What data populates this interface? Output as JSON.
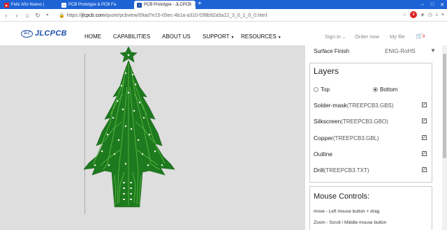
{
  "browser": {
    "tabs": [
      {
        "label": "Feliz Año Nuevo | ",
        "favicon": "youtube-icon",
        "color": "#e02020"
      },
      {
        "label": "PCB Prototype & PCB Fa",
        "favicon": "jlc-icon",
        "color": "#1f4fa8"
      },
      {
        "label": "PCB Prototype - JLCPCB",
        "favicon": "jlc-icon",
        "color": "#1f4fa8",
        "active": true
      }
    ],
    "new_tab": "+",
    "window_controls": [
      "–",
      "□",
      "✕"
    ],
    "address": {
      "prefix": "https://",
      "domain": "jlcpcb.com",
      "path": "/quote/pcbview/09ad7e15-05ec-4b1a-a310-f2f8b92a5a12_3_0_1_0_0.html"
    },
    "abp_count": "2"
  },
  "site": {
    "logo_text": "JLCPCB",
    "logo_badge": "JLC",
    "nav": [
      {
        "label": "HOME",
        "dropdown": false
      },
      {
        "label": "CAPABILITIES",
        "dropdown": false
      },
      {
        "label": "ABOUT US",
        "dropdown": false
      },
      {
        "label": "SUPPORT",
        "dropdown": true
      },
      {
        "label": "RESOURCES",
        "dropdown": true
      }
    ],
    "user_nav": {
      "signin": "Sign in",
      "new_quote": "Order now",
      "my_file": "My file",
      "cart_count": "0"
    }
  },
  "panel": {
    "surface_finish_label": "Surface Finish",
    "surface_finish_value": "ENIG-RoHS",
    "layers_title": "Layers",
    "side_options": [
      {
        "label": "Top",
        "selected": false
      },
      {
        "label": "Bottom",
        "selected": true
      }
    ],
    "layers": [
      {
        "name": "Solder-mask",
        "file": "(TREEPCB3.GBS)",
        "checked": true
      },
      {
        "name": "Silkscreen",
        "file": "(TREEPCB3.GBO)",
        "checked": true
      },
      {
        "name": "Copper",
        "file": "(TREEPCB3.GBL)",
        "checked": true
      },
      {
        "name": "Outline",
        "file": "",
        "checked": true
      },
      {
        "name": "Drill",
        "file": "(TREEPCB3.TXT)",
        "checked": true
      }
    ],
    "mouse_controls_title": "Mouse Controls:",
    "mouse_controls": [
      "move - Left mouse button + drag",
      "Zoom - Scroll / Middle mouse button"
    ]
  },
  "colors": {
    "browser_blue": "#1e63d6",
    "brand_blue": "#1f4fa8",
    "pcb_green": "#1e7a1e",
    "trace_green": "#4fae3c",
    "viewer_bg": "#dedede"
  }
}
